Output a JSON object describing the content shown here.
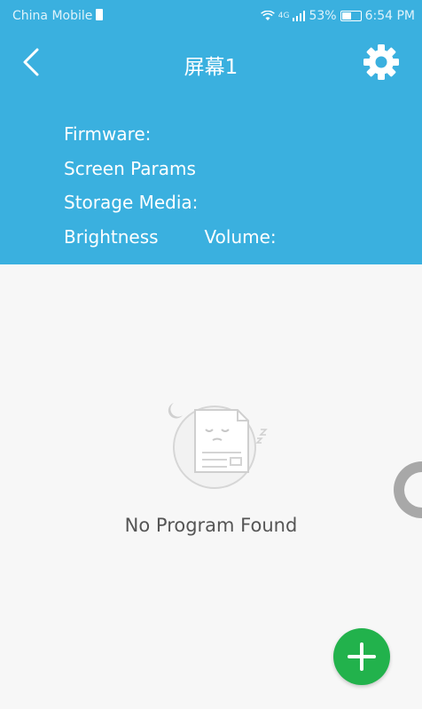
{
  "status_bar": {
    "carrier": "China Mobile",
    "network": "4G",
    "battery": "53%",
    "time": "6:54 PM"
  },
  "nav": {
    "title": "屏幕1",
    "back_icon": "chevron-left-icon",
    "settings_icon": "gear-icon"
  },
  "info": {
    "firmware_label": "Firmware:",
    "screen_params_label": "Screen Params",
    "storage_label": "Storage Media:",
    "brightness_label": "Brightness",
    "volume_label": "Volume:"
  },
  "empty_state": {
    "message": "No Program Found",
    "icon": "sleeping-document-icon"
  },
  "fab": {
    "icon": "plus-icon"
  },
  "colors": {
    "header": "#3ab0df",
    "background": "#f7f7f7",
    "fab": "#22b24c"
  }
}
